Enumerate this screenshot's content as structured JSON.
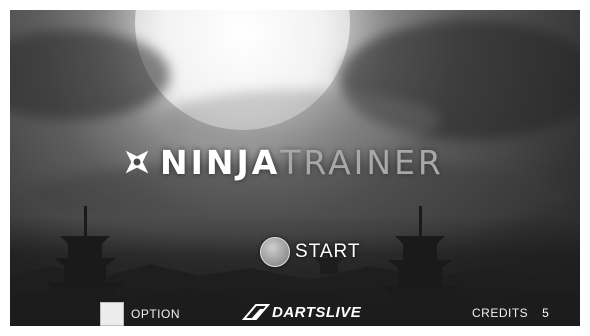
{
  "logo": {
    "part1": "NINJA",
    "part2": "TRAINER",
    "icon": "shuriken-icon"
  },
  "menu": {
    "start_label": "START",
    "option_label": "OPTION"
  },
  "brand": {
    "text": "DARTSLIVE",
    "icon": "dartslive-mark-icon"
  },
  "credits": {
    "label": "CREDITS",
    "value": "5"
  },
  "colors": {
    "logo_primary": "#ffffff",
    "logo_secondary": "#a8a8a8",
    "background": "#3a3a3a"
  }
}
